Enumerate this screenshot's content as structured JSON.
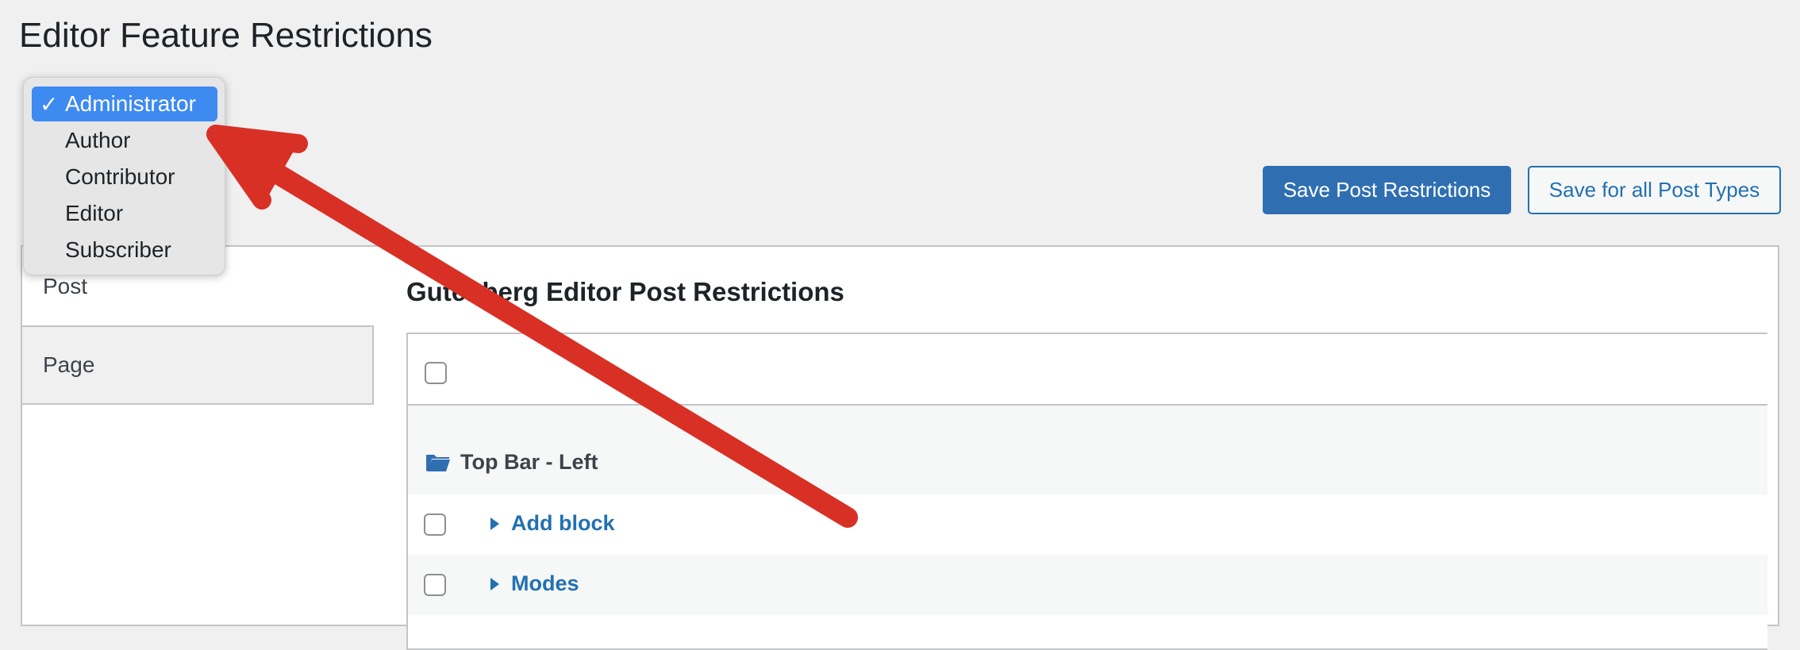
{
  "page": {
    "title": "Editor Feature Restrictions"
  },
  "roles": {
    "options": [
      "Administrator",
      "Author",
      "Contributor",
      "Editor",
      "Subscriber"
    ],
    "selected": "Administrator",
    "check_glyph": "✓"
  },
  "toolbar": {
    "save_post_label": "Save Post Restrictions",
    "save_all_label": "Save for all Post Types"
  },
  "tabs": [
    {
      "label": "Post"
    },
    {
      "label": "Page"
    }
  ],
  "section": {
    "title": "Gutenberg Editor Post Restrictions",
    "group": {
      "label": "Top Bar - Left",
      "icon": "folder-icon"
    },
    "items": [
      {
        "label": "Add block"
      },
      {
        "label": "Modes"
      }
    ]
  },
  "colors": {
    "primary": "#2f6fb1",
    "link": "#2271b1",
    "selection": "#3d8af0",
    "annotation": "#d93025"
  }
}
